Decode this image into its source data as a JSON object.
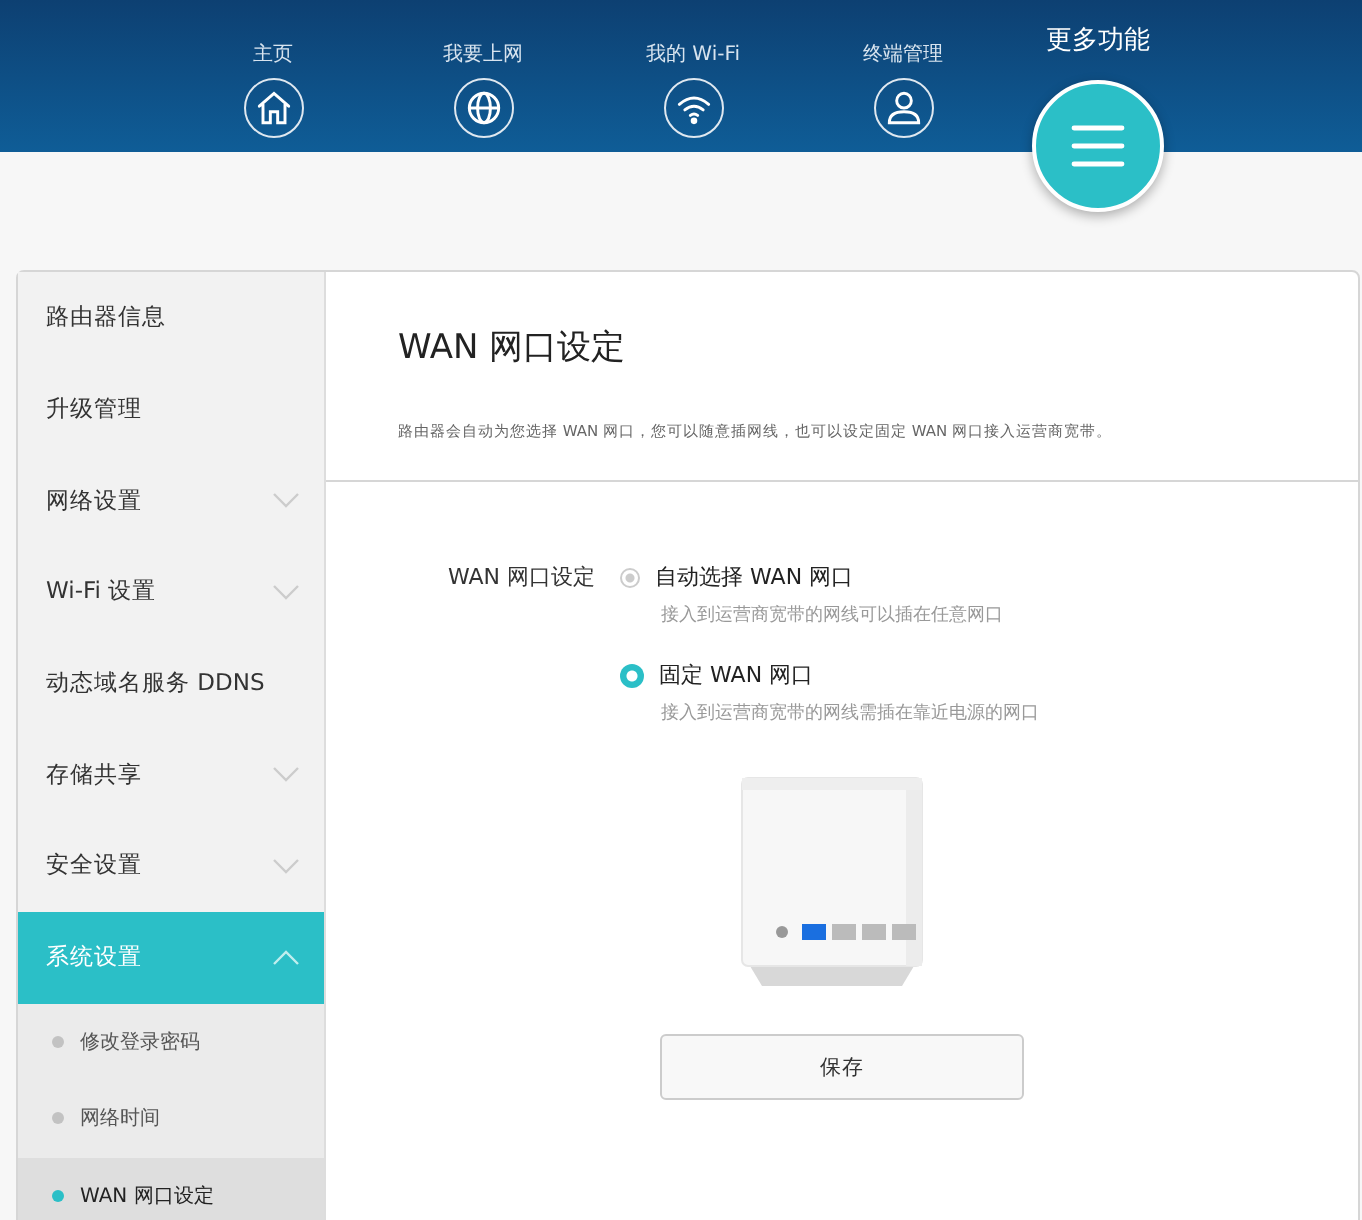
{
  "nav": [
    {
      "label": "主页",
      "selected": false
    },
    {
      "label": "我要上网",
      "selected": false
    },
    {
      "label": "我的 Wi-Fi",
      "selected": false
    },
    {
      "label": "终端管理",
      "selected": false
    },
    {
      "label": "更多功能",
      "selected": true
    }
  ],
  "sidebar": {
    "items": [
      {
        "label": "路由器信息"
      },
      {
        "label": "升级管理"
      },
      {
        "label": "网络设置",
        "expanded": false
      },
      {
        "label": "Wi-Fi 设置",
        "expanded": false
      },
      {
        "label": "动态域名服务 DDNS"
      },
      {
        "label": "存储共享",
        "expanded": false
      },
      {
        "label": "安全设置",
        "expanded": false
      },
      {
        "label": "系统设置",
        "expanded": true,
        "children": [
          {
            "label": "修改登录密码",
            "selected": false
          },
          {
            "label": "网络时间",
            "selected": false
          },
          {
            "label": "WAN 网口设定",
            "selected": true
          }
        ]
      }
    ]
  },
  "page": {
    "title": "WAN 网口设定",
    "description": "路由器会自动为您选择 WAN 网口，您可以随意插网线，也可以设定固定 WAN 网口接入运营商宽带。",
    "field_label": "WAN 网口设定",
    "options": [
      {
        "label": "自动选择 WAN 网口",
        "hint": "接入到运营商宽带的网线可以插在任意网口",
        "selected": false
      },
      {
        "label": "固定 WAN 网口",
        "hint": "接入到运营商宽带的网线需插在靠近电源的网口",
        "selected": true
      }
    ],
    "save_button": "保存"
  }
}
